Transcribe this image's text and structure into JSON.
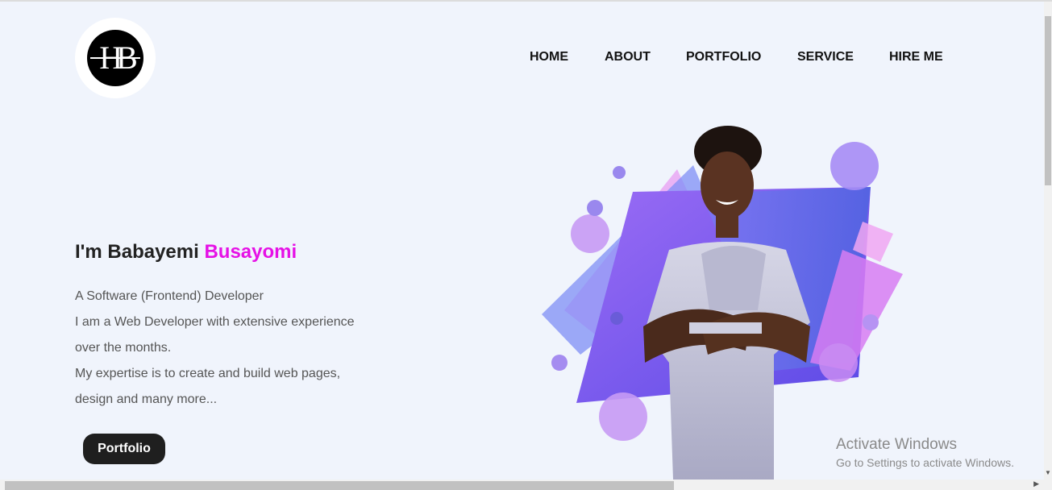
{
  "logo": {
    "letters": "HB"
  },
  "nav": [
    {
      "label": "HOME"
    },
    {
      "label": "ABOUT"
    },
    {
      "label": "PORTFOLIO"
    },
    {
      "label": "SERVICE"
    },
    {
      "label": "HIRE ME"
    }
  ],
  "hero": {
    "title_prefix": "I'm Babayemi ",
    "title_accent": "Busayomi",
    "lines": [
      "A Software (Frontend) Developer",
      "I am a Web Developer with extensive experience",
      "over the months.",
      "My expertise is to create and build web pages,",
      "design and many more..."
    ],
    "button_label": "Portfolio",
    "accent_color": "#e611e6"
  },
  "watermark": {
    "title": "Activate Windows",
    "subtitle": "Go to Settings to activate Windows."
  },
  "icons": {
    "scroll_down": "triangle-down",
    "scroll_right": "triangle-right"
  }
}
